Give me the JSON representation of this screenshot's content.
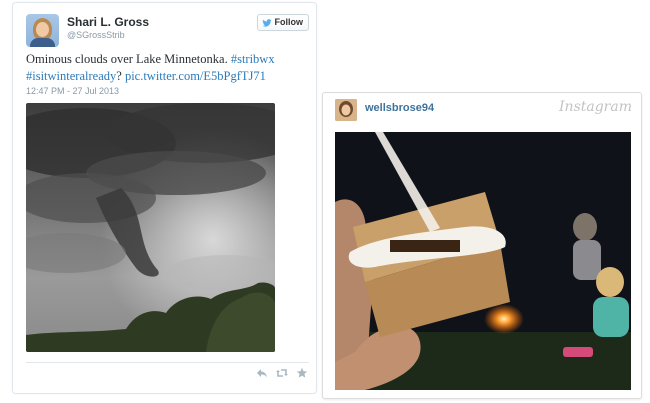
{
  "tweet": {
    "display_name": "Shari L. Gross",
    "handle": "@SGrossStrib",
    "follow_label": "Follow",
    "text_plain": "Ominous clouds over Lake Minnetonka. ",
    "hashtag1": "#stribwx",
    "hashtag2": "#isitwinteralready",
    "text_sep": "? ",
    "link": "pic.twitter.com/E5bPgfTJ71",
    "timestamp": "12:47 PM - 27 Jul 2013",
    "icons": {
      "follow": "twitter-bird-icon",
      "reply": "reply-icon",
      "retweet": "retweet-icon",
      "favorite": "star-icon"
    },
    "colors": {
      "link": "#2b7bb9",
      "muted": "#8899a6",
      "text": "#292f33"
    }
  },
  "instagram": {
    "username": "wellsbrose94",
    "logo_text": "Instagram",
    "colors": {
      "username": "#3f729b",
      "logo": "#c3c3c3"
    }
  }
}
